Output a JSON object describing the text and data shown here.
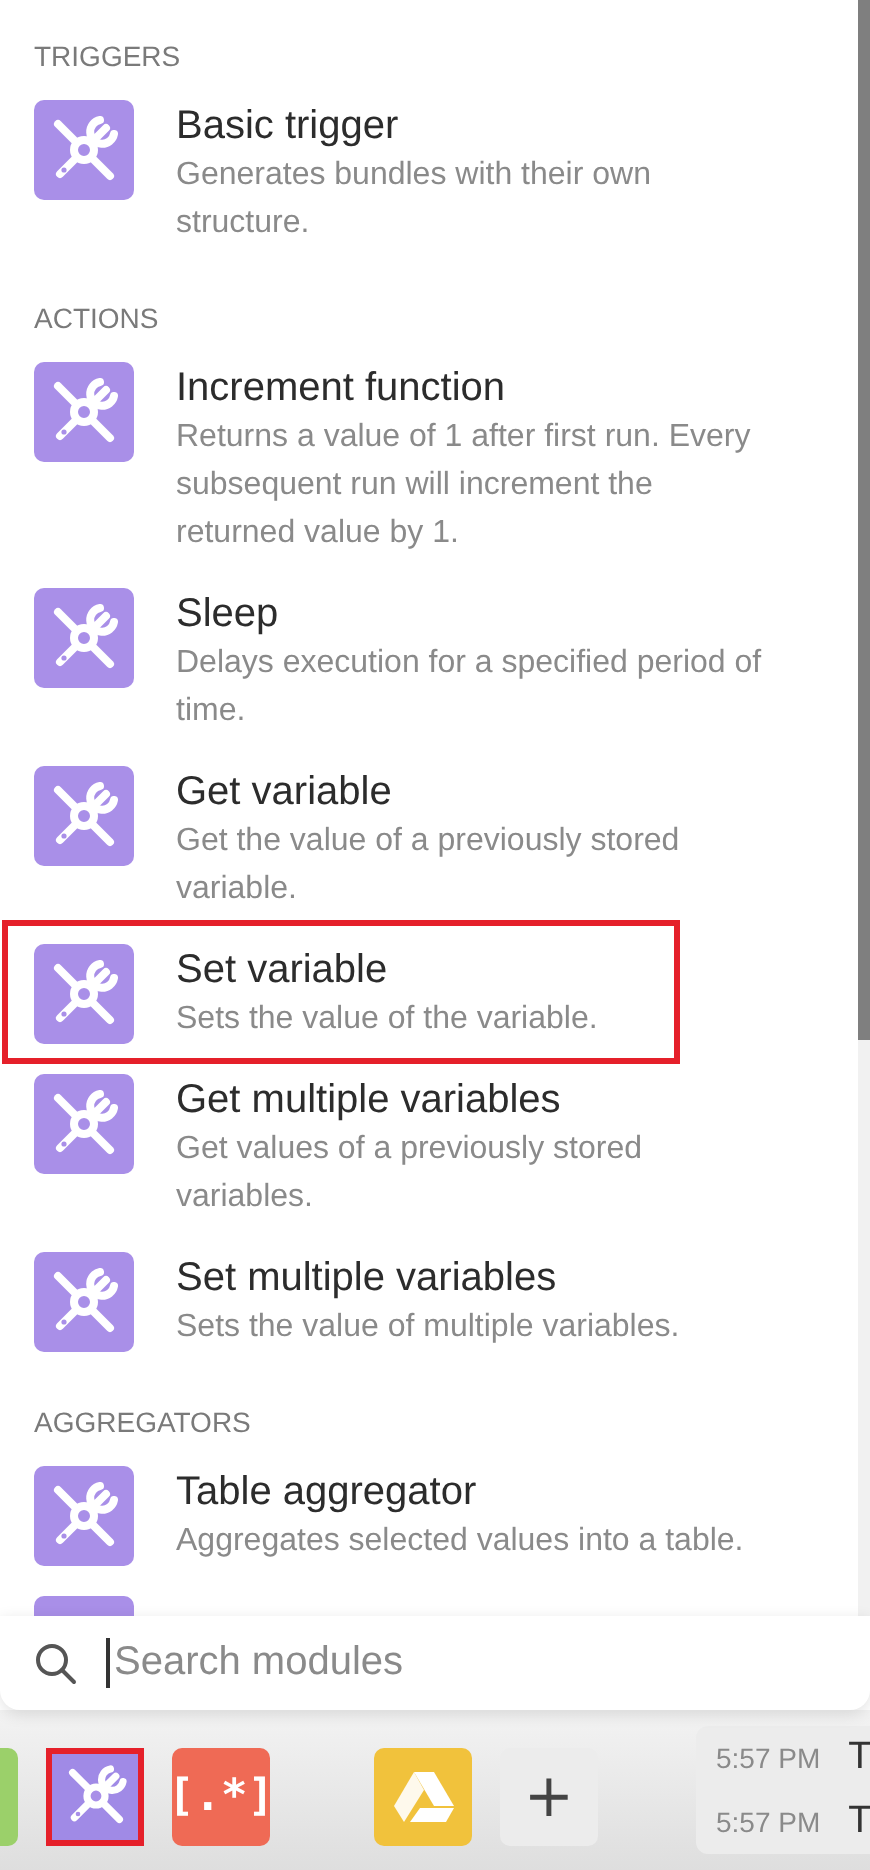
{
  "sections": [
    {
      "heading": "TRIGGERS",
      "modules": [
        {
          "title": "Basic trigger",
          "description": "Generates bundles with their own structure.",
          "highlighted": false
        }
      ]
    },
    {
      "heading": "ACTIONS",
      "modules": [
        {
          "title": "Increment function",
          "description": "Returns a value of 1 after first run. Every subsequent run will increment the returned value by 1.",
          "highlighted": false
        },
        {
          "title": "Sleep",
          "description": "Delays execution for a specified period of time.",
          "highlighted": false
        },
        {
          "title": "Get variable",
          "description": "Get the value of a previously stored variable.",
          "highlighted": false
        },
        {
          "title": "Set variable",
          "description": "Sets the value of the variable.",
          "highlighted": true
        },
        {
          "title": "Get multiple variables",
          "description": "Get values of a previously stored variables.",
          "highlighted": false
        },
        {
          "title": "Set multiple variables",
          "description": "Sets the value of multiple variables.",
          "highlighted": false
        }
      ]
    },
    {
      "heading": "AGGREGATORS",
      "modules": [
        {
          "title": "Table aggregator",
          "description": "Aggregates selected values into a table.",
          "highlighted": false
        }
      ]
    }
  ],
  "search": {
    "placeholder": "Search modules"
  },
  "toolbar": {
    "apps": [
      {
        "kind": "green",
        "highlighted": false
      },
      {
        "kind": "tools",
        "highlighted": true
      },
      {
        "kind": "regex",
        "label": "[.*]",
        "highlighted": false
      },
      {
        "kind": "drive",
        "highlighted": false
      },
      {
        "kind": "add",
        "label": "+",
        "highlighted": false
      }
    ]
  },
  "log": [
    {
      "time": "5:57 PM",
      "text": "T"
    },
    {
      "time": "5:57 PM",
      "text": "T"
    }
  ]
}
